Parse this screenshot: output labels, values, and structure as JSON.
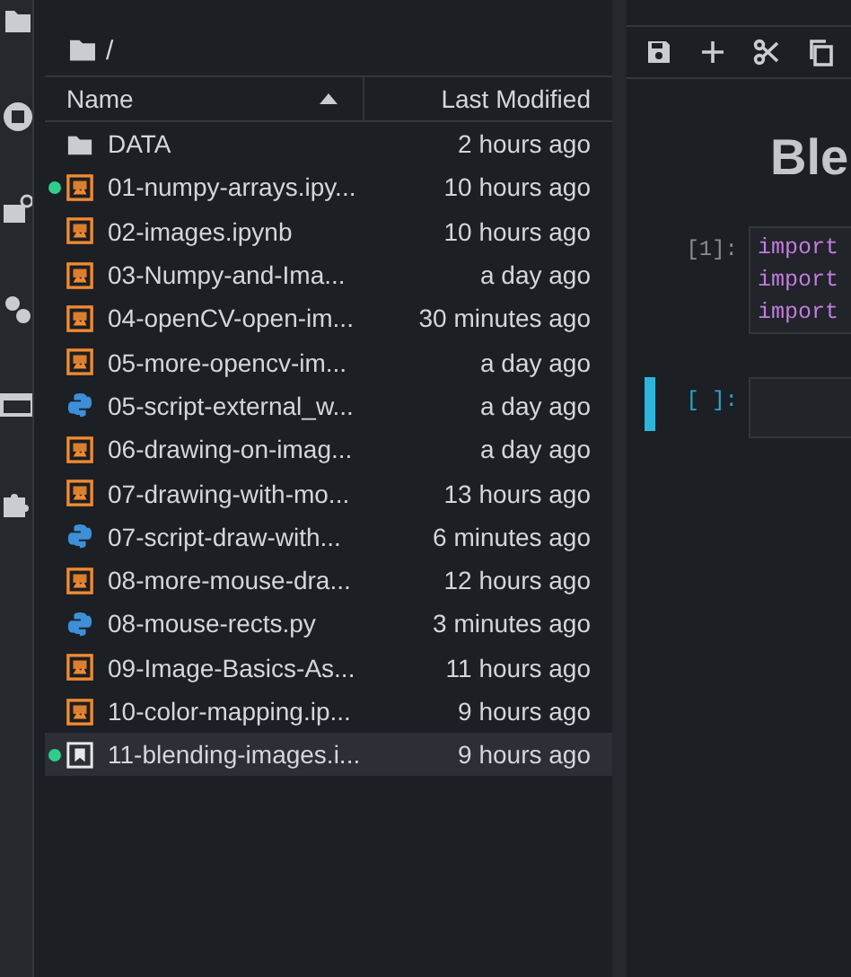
{
  "breadcrumb": "/",
  "columns": [
    {
      "label": "Name",
      "sorted_ascending": true
    },
    {
      "label": "Last Modified"
    }
  ],
  "files": [
    {
      "kind": "folder",
      "name": "DATA",
      "modified": "2 hours ago",
      "running": false,
      "selected": false
    },
    {
      "kind": "notebook",
      "name": "01-numpy-arrays.ipy...",
      "modified": "10 hours ago",
      "running": true,
      "selected": false
    },
    {
      "kind": "notebook",
      "name": "02-images.ipynb",
      "modified": "10 hours ago",
      "running": false,
      "selected": false
    },
    {
      "kind": "notebook",
      "name": "03-Numpy-and-Ima...",
      "modified": "a day ago",
      "running": false,
      "selected": false
    },
    {
      "kind": "notebook",
      "name": "04-openCV-open-im...",
      "modified": "30 minutes ago",
      "running": false,
      "selected": false
    },
    {
      "kind": "notebook",
      "name": "05-more-opencv-im...",
      "modified": "a day ago",
      "running": false,
      "selected": false
    },
    {
      "kind": "python",
      "name": "05-script-external_w...",
      "modified": "a day ago",
      "running": false,
      "selected": false
    },
    {
      "kind": "notebook",
      "name": "06-drawing-on-imag...",
      "modified": "a day ago",
      "running": false,
      "selected": false
    },
    {
      "kind": "notebook",
      "name": "07-drawing-with-mo...",
      "modified": "13 hours ago",
      "running": false,
      "selected": false
    },
    {
      "kind": "python",
      "name": "07-script-draw-with...",
      "modified": "6 minutes ago",
      "running": false,
      "selected": false
    },
    {
      "kind": "notebook",
      "name": "08-more-mouse-dra...",
      "modified": "12 hours ago",
      "running": false,
      "selected": false
    },
    {
      "kind": "python",
      "name": "08-mouse-rects.py",
      "modified": "3 minutes ago",
      "running": false,
      "selected": false
    },
    {
      "kind": "notebook",
      "name": "09-Image-Basics-As...",
      "modified": "11 hours ago",
      "running": false,
      "selected": false
    },
    {
      "kind": "notebook",
      "name": "10-color-mapping.ip...",
      "modified": "9 hours ago",
      "running": false,
      "selected": false
    },
    {
      "kind": "notebook",
      "name": "11-blending-images.i...",
      "modified": "9 hours ago",
      "running": true,
      "selected": true
    }
  ],
  "notebook": {
    "heading": "Ble",
    "cells": [
      {
        "prompt": "[1]:",
        "lines": [
          "import",
          "import",
          "import"
        ],
        "active": false
      },
      {
        "prompt": "[ ]:",
        "active": true
      }
    ]
  }
}
